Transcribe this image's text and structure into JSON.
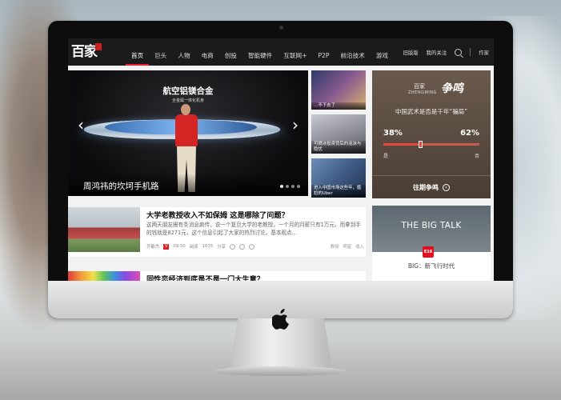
{
  "nav": {
    "logo": "百家",
    "items": [
      "首页",
      "巨头",
      "人物",
      "电商",
      "创投",
      "智能硬件",
      "互联网+",
      "P2P",
      "前沿技术",
      "游戏"
    ],
    "right": {
      "old_version": "旧版版",
      "follow": "我的关注",
      "author": "作家"
    }
  },
  "slider": {
    "slide_title": "航空铝镁合金",
    "slide_sub": "全金属一体化机身",
    "caption": "周鸿祎的坎坷手机路",
    "prev": "‹",
    "next": "›"
  },
  "thumbs": [
    {
      "label": "…不下去了"
    },
    {
      "label": "可燃冰投资背后的泡沫与隐忧"
    },
    {
      "label": "进入中国市场这些年，尴尬的Uber"
    }
  ],
  "debate": {
    "brand": "百家",
    "brand_en": "ZHENGMING",
    "brush": "争鸣",
    "question": "中国武术是否是千年“骗局”",
    "pct_left": "38%",
    "pct_right": "62%",
    "side_left": "是",
    "side_right": "否",
    "link": "往期争鸣",
    "split": 0.38
  },
  "articles": [
    {
      "title": "大学老教授收入不如保姆 这是哪除了问题？",
      "summary": "这两天朋友圈有条消息疯传，说一个复旦大学的老教授，一个月的月薪只有1万元，而拿到手的钱就是8271元，这个信息引起了大家的热烈讨论。基本观点...",
      "author": "齐敏杰",
      "v": "V",
      "time": "09:50",
      "read_label": "阅读",
      "reads": "1635",
      "share": "分享",
      "tags": [
        "教授",
        "明星",
        "收入"
      ]
    },
    {
      "title": "同性恋经济到底是不是一门大生意？"
    }
  ],
  "bigtalk": {
    "title": "THE BIG TALK",
    "badge": "E16",
    "caption": "BIG：新飞行时代"
  },
  "colors": {
    "accent": "#e2202f",
    "nav_bg": "#1b1b1b",
    "debate_red": "#e8453c"
  }
}
